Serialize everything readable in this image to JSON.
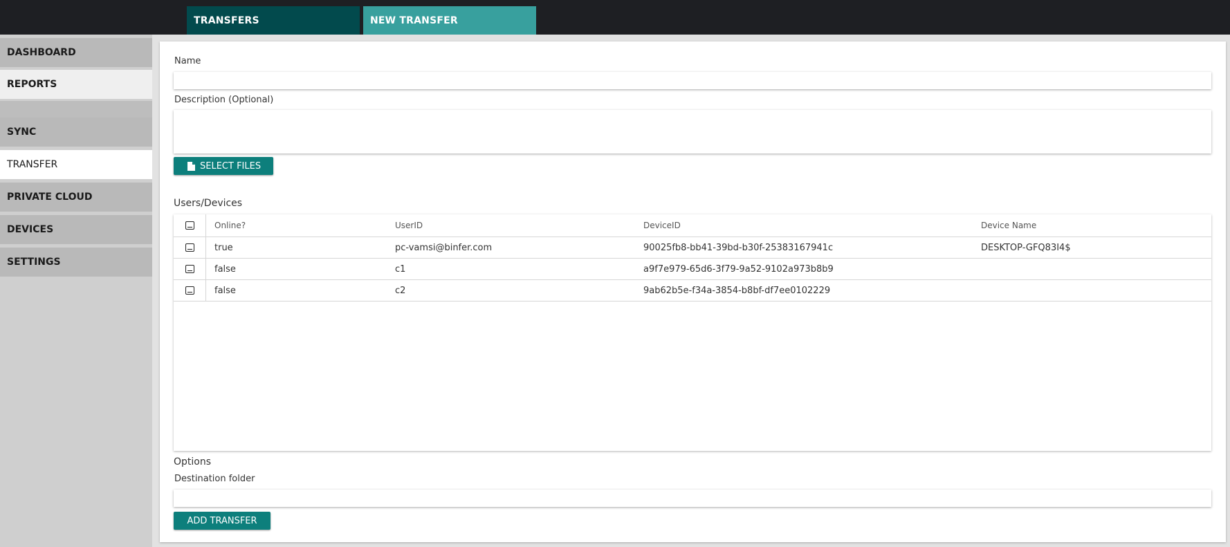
{
  "top_tabs": {
    "transfers": "TRANSFERS",
    "new_transfer": "NEW TRANSFER"
  },
  "sidebar": {
    "items": [
      {
        "label": "DASHBOARD"
      },
      {
        "label": "REPORTS"
      },
      {
        "label": "SYNC"
      },
      {
        "label": "TRANSFER"
      },
      {
        "label": "PRIVATE CLOUD"
      },
      {
        "label": "DEVICES"
      },
      {
        "label": "SETTINGS"
      }
    ],
    "active": "TRANSFER"
  },
  "form": {
    "name_label": "Name",
    "name_value": "",
    "description_label": "Description (Optional)",
    "description_value": "",
    "select_files_label": "SELECT FILES",
    "select_files_icon": "file-icon",
    "users_devices_title": "Users/Devices",
    "table": {
      "columns": [
        "Online?",
        "UserID",
        "DeviceID",
        "Device Name"
      ],
      "rows": [
        {
          "online": "true",
          "user_id": "pc-vamsi@binfer.com",
          "device_id": "90025fb8-bb41-39bd-b30f-25383167941c",
          "device_name": "DESKTOP-GFQ83I4$"
        },
        {
          "online": "false",
          "user_id": "c1",
          "device_id": "a9f7e979-65d6-3f79-9a52-9102a973b8b9",
          "device_name": ""
        },
        {
          "online": "false",
          "user_id": "c2",
          "device_id": "9ab62b5e-f34a-3854-b8bf-df7ee0102229",
          "device_name": ""
        }
      ]
    },
    "options_title": "Options",
    "destination_label": "Destination folder",
    "destination_value": "",
    "add_transfer_label": "ADD TRANSFER"
  },
  "colors": {
    "topbar": "#1e1f23",
    "tab_transfers": "#024a4d",
    "tab_new_transfer": "#38a09e",
    "button": "#0d7f7c",
    "sidebar": "#cfcfcf"
  }
}
